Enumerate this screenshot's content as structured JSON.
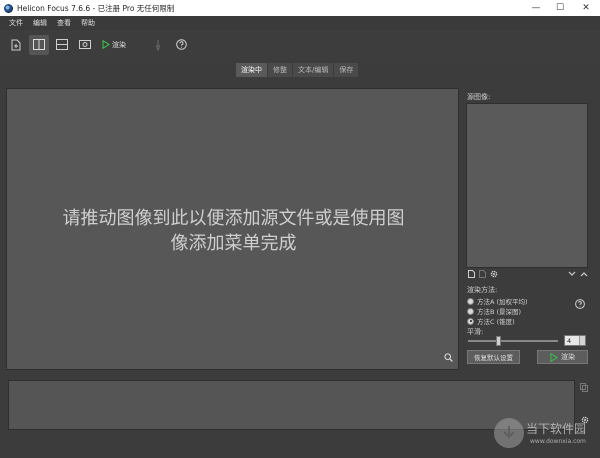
{
  "window": {
    "title": "Helicon Focus 7.6.6 - 已注册 Pro 无任何限制",
    "minimize": "—",
    "maximize": "☐",
    "close": "✕"
  },
  "menu": [
    "文件",
    "编辑",
    "查看",
    "帮助"
  ],
  "toolbar": {
    "render_label": "渲染"
  },
  "tabs": [
    {
      "label": "渲染中",
      "active": true
    },
    {
      "label": "修整",
      "active": false
    },
    {
      "label": "文本/编辑",
      "active": false
    },
    {
      "label": "保存",
      "active": false
    }
  ],
  "canvas": {
    "drop_hint_line1": "请推动图像到此以便添加源文件或是使用图",
    "drop_hint_line2": "像添加菜单完成"
  },
  "side": {
    "source_label": "源图像:",
    "method_title": "渲染方法:",
    "methods": [
      {
        "label": "方法A (加权平均)",
        "selected": false
      },
      {
        "label": "方法B (景深图)",
        "selected": false
      },
      {
        "label": "方法C (锥度)",
        "selected": true
      }
    ],
    "smoothing_label": "平滑:",
    "smoothing_value": "4",
    "reset_button": "恢复默认设置",
    "render_button": "渲染"
  },
  "watermark": {
    "name": "当下软件园",
    "url": "www.downxia.com"
  },
  "colors": {
    "accent_green": "#3fb34f",
    "panel_bg": "#3c3c3c",
    "canvas_bg": "#575757"
  }
}
